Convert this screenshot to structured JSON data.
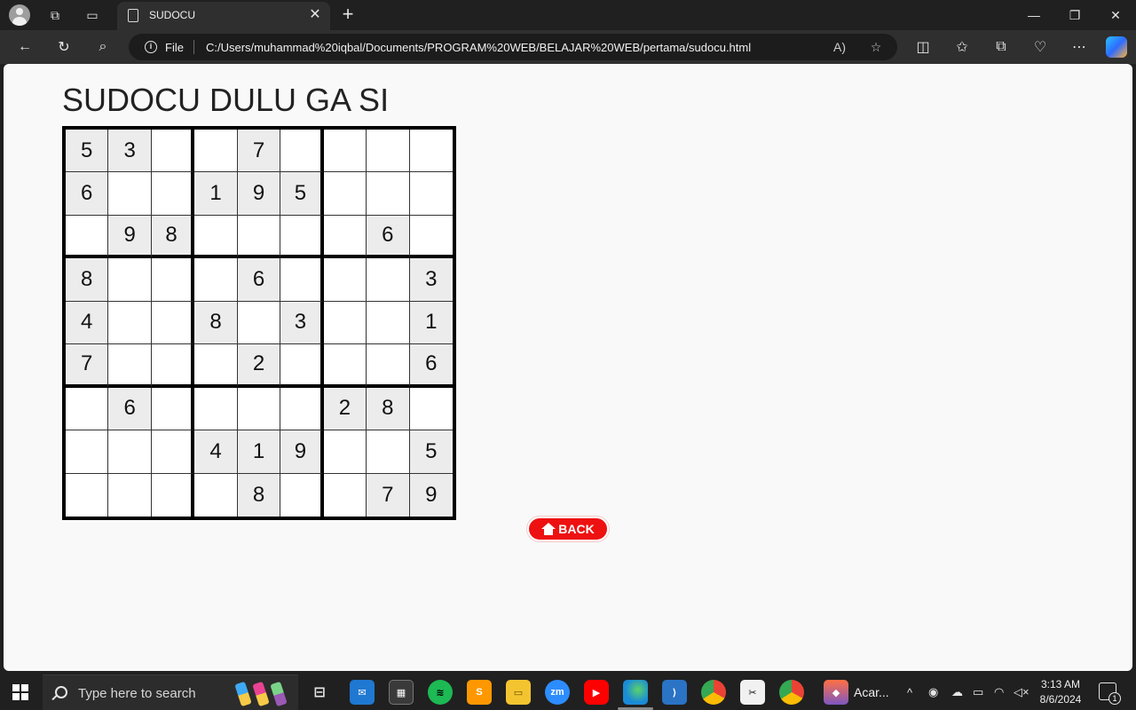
{
  "browser": {
    "tab_title": "SUDOCU",
    "address_scheme_label": "File",
    "url": "C:/Users/muhammad%20iqbal/Documents/PROGRAM%20WEB/BELAJAR%20WEB/pertama/sudocu.html"
  },
  "page": {
    "heading": "SUDOCU DULU GA SI",
    "back_button_label": "BACK",
    "colors": {
      "back_button": "#ee1111",
      "given_cell": "#ececec"
    },
    "sudoku_grid": [
      [
        "5",
        "3",
        "",
        "",
        "7",
        "",
        "",
        "",
        ""
      ],
      [
        "6",
        "",
        "",
        "1",
        "9",
        "5",
        "",
        "",
        ""
      ],
      [
        "",
        "9",
        "8",
        "",
        "",
        "",
        "",
        "6",
        ""
      ],
      [
        "8",
        "",
        "",
        "",
        "6",
        "",
        "",
        "",
        "3"
      ],
      [
        "4",
        "",
        "",
        "8",
        "",
        "3",
        "",
        "",
        "1"
      ],
      [
        "7",
        "",
        "",
        "",
        "2",
        "",
        "",
        "",
        "6"
      ],
      [
        "",
        "6",
        "",
        "",
        "",
        "",
        "2",
        "8",
        ""
      ],
      [
        "",
        "",
        "",
        "4",
        "1",
        "9",
        "",
        "",
        "5"
      ],
      [
        "",
        "",
        "",
        "",
        "8",
        "",
        "",
        "7",
        "9"
      ]
    ]
  },
  "taskbar": {
    "search_placeholder": "Type here to search",
    "active_window_label": "Acar...",
    "time": "3:13 AM",
    "date": "8/6/2024",
    "notification_count": "1"
  }
}
